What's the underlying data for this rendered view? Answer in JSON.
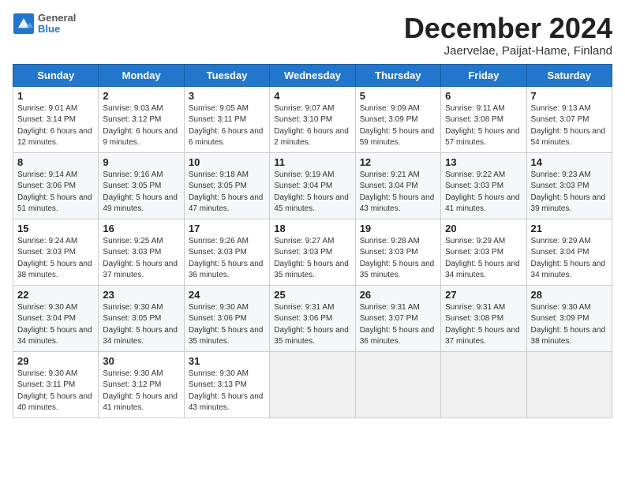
{
  "header": {
    "logo_general": "General",
    "logo_blue": "Blue",
    "title": "December 2024",
    "subtitle": "Jaervelae, Paijat-Hame, Finland"
  },
  "days_of_week": [
    "Sunday",
    "Monday",
    "Tuesday",
    "Wednesday",
    "Thursday",
    "Friday",
    "Saturday"
  ],
  "weeks": [
    [
      {
        "day": "1",
        "sunrise": "Sunrise: 9:01 AM",
        "sunset": "Sunset: 3:14 PM",
        "daylight": "Daylight: 6 hours and 12 minutes."
      },
      {
        "day": "2",
        "sunrise": "Sunrise: 9:03 AM",
        "sunset": "Sunset: 3:12 PM",
        "daylight": "Daylight: 6 hours and 9 minutes."
      },
      {
        "day": "3",
        "sunrise": "Sunrise: 9:05 AM",
        "sunset": "Sunset: 3:11 PM",
        "daylight": "Daylight: 6 hours and 6 minutes."
      },
      {
        "day": "4",
        "sunrise": "Sunrise: 9:07 AM",
        "sunset": "Sunset: 3:10 PM",
        "daylight": "Daylight: 6 hours and 2 minutes."
      },
      {
        "day": "5",
        "sunrise": "Sunrise: 9:09 AM",
        "sunset": "Sunset: 3:09 PM",
        "daylight": "Daylight: 5 hours and 59 minutes."
      },
      {
        "day": "6",
        "sunrise": "Sunrise: 9:11 AM",
        "sunset": "Sunset: 3:08 PM",
        "daylight": "Daylight: 5 hours and 57 minutes."
      },
      {
        "day": "7",
        "sunrise": "Sunrise: 9:13 AM",
        "sunset": "Sunset: 3:07 PM",
        "daylight": "Daylight: 5 hours and 54 minutes."
      }
    ],
    [
      {
        "day": "8",
        "sunrise": "Sunrise: 9:14 AM",
        "sunset": "Sunset: 3:06 PM",
        "daylight": "Daylight: 5 hours and 51 minutes."
      },
      {
        "day": "9",
        "sunrise": "Sunrise: 9:16 AM",
        "sunset": "Sunset: 3:05 PM",
        "daylight": "Daylight: 5 hours and 49 minutes."
      },
      {
        "day": "10",
        "sunrise": "Sunrise: 9:18 AM",
        "sunset": "Sunset: 3:05 PM",
        "daylight": "Daylight: 5 hours and 47 minutes."
      },
      {
        "day": "11",
        "sunrise": "Sunrise: 9:19 AM",
        "sunset": "Sunset: 3:04 PM",
        "daylight": "Daylight: 5 hours and 45 minutes."
      },
      {
        "day": "12",
        "sunrise": "Sunrise: 9:21 AM",
        "sunset": "Sunset: 3:04 PM",
        "daylight": "Daylight: 5 hours and 43 minutes."
      },
      {
        "day": "13",
        "sunrise": "Sunrise: 9:22 AM",
        "sunset": "Sunset: 3:03 PM",
        "daylight": "Daylight: 5 hours and 41 minutes."
      },
      {
        "day": "14",
        "sunrise": "Sunrise: 9:23 AM",
        "sunset": "Sunset: 3:03 PM",
        "daylight": "Daylight: 5 hours and 39 minutes."
      }
    ],
    [
      {
        "day": "15",
        "sunrise": "Sunrise: 9:24 AM",
        "sunset": "Sunset: 3:03 PM",
        "daylight": "Daylight: 5 hours and 38 minutes."
      },
      {
        "day": "16",
        "sunrise": "Sunrise: 9:25 AM",
        "sunset": "Sunset: 3:03 PM",
        "daylight": "Daylight: 5 hours and 37 minutes."
      },
      {
        "day": "17",
        "sunrise": "Sunrise: 9:26 AM",
        "sunset": "Sunset: 3:03 PM",
        "daylight": "Daylight: 5 hours and 36 minutes."
      },
      {
        "day": "18",
        "sunrise": "Sunrise: 9:27 AM",
        "sunset": "Sunset: 3:03 PM",
        "daylight": "Daylight: 5 hours and 35 minutes."
      },
      {
        "day": "19",
        "sunrise": "Sunrise: 9:28 AM",
        "sunset": "Sunset: 3:03 PM",
        "daylight": "Daylight: 5 hours and 35 minutes."
      },
      {
        "day": "20",
        "sunrise": "Sunrise: 9:29 AM",
        "sunset": "Sunset: 3:03 PM",
        "daylight": "Daylight: 5 hours and 34 minutes."
      },
      {
        "day": "21",
        "sunrise": "Sunrise: 9:29 AM",
        "sunset": "Sunset: 3:04 PM",
        "daylight": "Daylight: 5 hours and 34 minutes."
      }
    ],
    [
      {
        "day": "22",
        "sunrise": "Sunrise: 9:30 AM",
        "sunset": "Sunset: 3:04 PM",
        "daylight": "Daylight: 5 hours and 34 minutes."
      },
      {
        "day": "23",
        "sunrise": "Sunrise: 9:30 AM",
        "sunset": "Sunset: 3:05 PM",
        "daylight": "Daylight: 5 hours and 34 minutes."
      },
      {
        "day": "24",
        "sunrise": "Sunrise: 9:30 AM",
        "sunset": "Sunset: 3:06 PM",
        "daylight": "Daylight: 5 hours and 35 minutes."
      },
      {
        "day": "25",
        "sunrise": "Sunrise: 9:31 AM",
        "sunset": "Sunset: 3:06 PM",
        "daylight": "Daylight: 5 hours and 35 minutes."
      },
      {
        "day": "26",
        "sunrise": "Sunrise: 9:31 AM",
        "sunset": "Sunset: 3:07 PM",
        "daylight": "Daylight: 5 hours and 36 minutes."
      },
      {
        "day": "27",
        "sunrise": "Sunrise: 9:31 AM",
        "sunset": "Sunset: 3:08 PM",
        "daylight": "Daylight: 5 hours and 37 minutes."
      },
      {
        "day": "28",
        "sunrise": "Sunrise: 9:30 AM",
        "sunset": "Sunset: 3:09 PM",
        "daylight": "Daylight: 5 hours and 38 minutes."
      }
    ],
    [
      {
        "day": "29",
        "sunrise": "Sunrise: 9:30 AM",
        "sunset": "Sunset: 3:11 PM",
        "daylight": "Daylight: 5 hours and 40 minutes."
      },
      {
        "day": "30",
        "sunrise": "Sunrise: 9:30 AM",
        "sunset": "Sunset: 3:12 PM",
        "daylight": "Daylight: 5 hours and 41 minutes."
      },
      {
        "day": "31",
        "sunrise": "Sunrise: 9:30 AM",
        "sunset": "Sunset: 3:13 PM",
        "daylight": "Daylight: 5 hours and 43 minutes."
      },
      null,
      null,
      null,
      null
    ]
  ]
}
